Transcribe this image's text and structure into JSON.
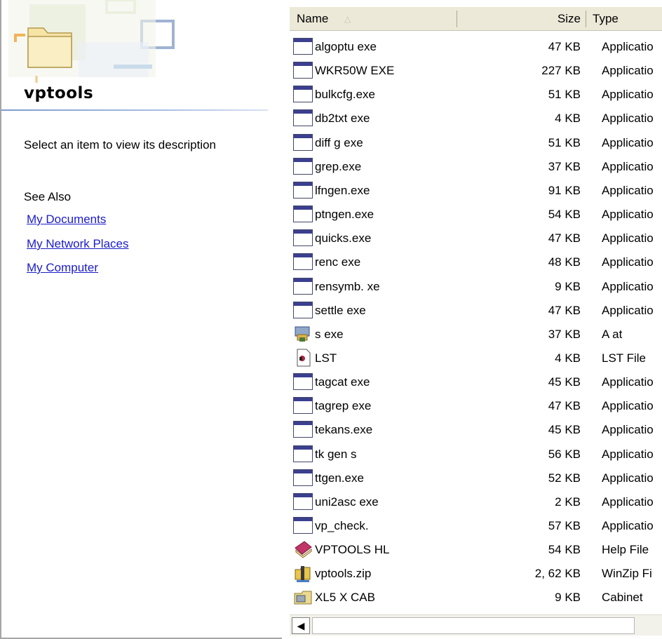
{
  "folder_title": "vptools",
  "description": "Select an item to view its description",
  "see_also": {
    "label": "See Also",
    "links": [
      "My Documents",
      "My Network Places",
      "My Computer"
    ]
  },
  "columns": {
    "name": "Name",
    "size": "Size",
    "type": "Type"
  },
  "files": [
    {
      "name": "algoptu exe",
      "size": "47 KB",
      "type": "Applicatio",
      "icon": "exe-icon"
    },
    {
      "name": "WKR50W EXE",
      "size": "227 KB",
      "type": "Applicatio",
      "icon": "exe-icon"
    },
    {
      "name": "bulkcfg.exe",
      "size": "51 KB",
      "type": "Applicatio",
      "icon": "exe-icon"
    },
    {
      "name": "db2txt exe",
      "size": "4 KB",
      "type": "Applicatio",
      "icon": "exe-icon"
    },
    {
      "name": "diff g exe",
      "size": "51 KB",
      "type": "Applicatio",
      "icon": "exe-icon"
    },
    {
      "name": "grep.exe",
      "size": "37 KB",
      "type": "Applicatio",
      "icon": "exe-icon"
    },
    {
      "name": "lfngen.exe",
      "size": "91 KB",
      "type": "Applicatio",
      "icon": "exe-icon"
    },
    {
      "name": "ptngen.exe",
      "size": "54 KB",
      "type": "Applicatio",
      "icon": "exe-icon"
    },
    {
      "name": "quicks.exe",
      "size": "47 KB",
      "type": "Applicatio",
      "icon": "exe-icon"
    },
    {
      "name": "renc exe",
      "size": "48 KB",
      "type": "Applicatio",
      "icon": "exe-icon"
    },
    {
      "name": "rensymb. xe",
      "size": "9 KB",
      "type": "Applicatio",
      "icon": "exe-icon"
    },
    {
      "name": "settle exe",
      "size": "47 KB",
      "type": "Applicatio",
      "icon": "exe-icon"
    },
    {
      "name": "s exe",
      "size": "37 KB",
      "type": "A at",
      "icon": "setup-icon"
    },
    {
      "name": "LST",
      "size": "4 KB",
      "type": "LST File",
      "icon": "lst-file-icon"
    },
    {
      "name": "tagcat exe",
      "size": "45 KB",
      "type": "Applicatio",
      "icon": "exe-icon"
    },
    {
      "name": "tagrep exe",
      "size": "47 KB",
      "type": "Applicatio",
      "icon": "exe-icon"
    },
    {
      "name": "tekans.exe",
      "size": "45 KB",
      "type": "Applicatio",
      "icon": "exe-icon"
    },
    {
      "name": "tk gen s",
      "size": "56 KB",
      "type": "Applicatio",
      "icon": "exe-icon"
    },
    {
      "name": "ttgen.exe",
      "size": "52 KB",
      "type": "Applicatio",
      "icon": "exe-icon"
    },
    {
      "name": "uni2asc exe",
      "size": "2 KB",
      "type": "Applicatio",
      "icon": "exe-icon"
    },
    {
      "name": "vp_check.",
      "size": "57 KB",
      "type": "Applicatio",
      "icon": "exe-icon"
    },
    {
      "name": "VPTOOLS HL",
      "size": "54 KB",
      "type": "Help File",
      "icon": "help-file-icon"
    },
    {
      "name": "vptools.zip",
      "size": "2, 62 KB",
      "type": "WinZip Fi",
      "icon": "winzip-icon"
    },
    {
      "name": "XL5 X CAB",
      "size": "9 KB",
      "type": "Cabinet",
      "icon": "cabinet-icon"
    }
  ]
}
